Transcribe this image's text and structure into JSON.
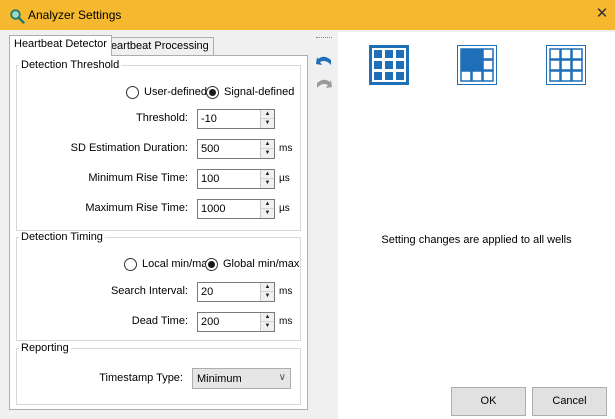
{
  "window": {
    "title": "Analyzer Settings",
    "title_icon": "magnifier-icon",
    "close_icon": "close-icon",
    "titlebar_color": "#f5b82e"
  },
  "tabs": [
    {
      "label": "Heartbeat Detector",
      "active": true
    },
    {
      "label": "Heartbeat Processing",
      "active": false
    }
  ],
  "detection_threshold": {
    "title": "Detection Threshold",
    "mode_options": [
      "User-defined",
      "Signal-defined"
    ],
    "selected_mode": "Signal-defined",
    "threshold": {
      "label": "Threshold:",
      "value": "-10",
      "unit": ""
    },
    "sd_duration": {
      "label": "SD Estimation Duration:",
      "value": "500",
      "unit": "ms"
    },
    "min_rise": {
      "label": "Minimum Rise Time:",
      "value": "100",
      "unit": "µs"
    },
    "max_rise": {
      "label": "Maximum Rise Time:",
      "value": "1000",
      "unit": "µs"
    }
  },
  "detection_timing": {
    "title": "Detection Timing",
    "mode_options": [
      "Local min/max",
      "Global min/max"
    ],
    "selected_mode": "Global min/max",
    "search_interval": {
      "label": "Search Interval:",
      "value": "20",
      "unit": "ms"
    },
    "dead_time": {
      "label": "Dead Time:",
      "value": "200",
      "unit": "ms"
    }
  },
  "reporting": {
    "title": "Reporting",
    "timestamp_type": {
      "label": "Timestamp Type:",
      "value": "Minimum"
    }
  },
  "toolbar": {
    "undo_icon": "undo-icon",
    "redo_icon": "redo-icon",
    "well_views": [
      "all-wells-grid-icon",
      "partial-wells-grid-icon",
      "empty-wells-grid-icon"
    ],
    "accent_color": "#1e6fb8"
  },
  "message": "Setting changes are applied to all wells",
  "buttons": {
    "ok": "OK",
    "cancel": "Cancel"
  }
}
